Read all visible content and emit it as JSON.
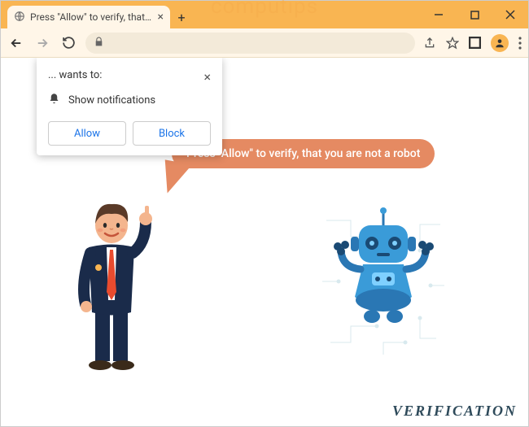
{
  "window": {
    "tab_title": "Press \"Allow\" to verify, that you a",
    "watermark": "computips"
  },
  "prompt": {
    "wants_to": "... wants to:",
    "permission_label": "Show notifications",
    "allow_label": "Allow",
    "block_label": "Block"
  },
  "content": {
    "bubble_text": "Press \"Allow\" to verify, that you are not a robot",
    "footer_text": "VERIFICATION"
  }
}
